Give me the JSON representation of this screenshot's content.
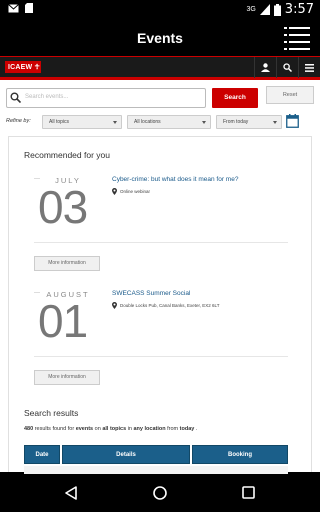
{
  "status": {
    "network": "3G",
    "time": "3:57"
  },
  "header": {
    "title": "Events"
  },
  "brand": {
    "logo_text": "ICAEW"
  },
  "search": {
    "placeholder": "Search events...",
    "search_label": "Search",
    "reset_label": "Reset"
  },
  "refine": {
    "label": "Refine by:",
    "topic": "All topics",
    "location": "All locations",
    "date": "From today"
  },
  "recommended": {
    "heading": "Recommended for you",
    "events": [
      {
        "month": "JULY",
        "day": "03",
        "title": "Cyber-crime: but what does it mean for me?",
        "location": "Online webinar",
        "more_label": "More information"
      },
      {
        "month": "AUGUST",
        "day": "01",
        "title": "SWECASS Summer Social",
        "location": "Double Locks Pub, Canal Banks, Exeter, EX2 6LT",
        "more_label": "More information"
      }
    ]
  },
  "results": {
    "heading": "Search results",
    "count": "480",
    "text_1": "results found for",
    "word_events": "events",
    "text_2": "on",
    "word_topics": "all topics",
    "text_3": "in",
    "word_location": "any location",
    "text_4": "from",
    "word_date": "today",
    "text_5": ".",
    "columns": [
      "Date",
      "Details",
      "Booking"
    ]
  },
  "colors": {
    "accent": "#cc0000",
    "table_header": "#1b5f8a",
    "link": "#1a5a8a"
  }
}
